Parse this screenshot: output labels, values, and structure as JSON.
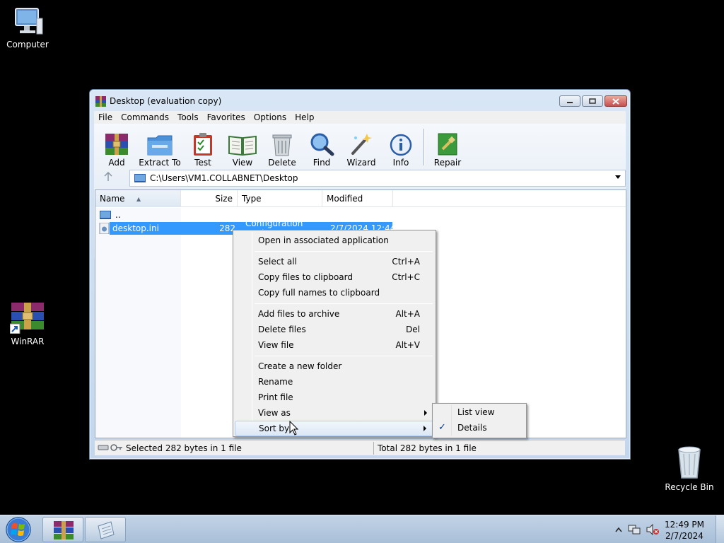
{
  "desktop": {
    "icons": [
      {
        "label": "Computer"
      },
      {
        "label": "WinRAR"
      },
      {
        "label": "Recycle Bin"
      }
    ]
  },
  "window": {
    "title": "Desktop (evaluation copy)",
    "menu": [
      "File",
      "Commands",
      "Tools",
      "Favorites",
      "Options",
      "Help"
    ],
    "toolbar": {
      "add": "Add",
      "extract": "Extract To",
      "test": "Test",
      "view": "View",
      "delete": "Delete",
      "find": "Find",
      "wizard": "Wizard",
      "info": "Info",
      "repair": "Repair"
    },
    "address": "C:\\Users\\VM1.COLLABNET\\Desktop",
    "columns": {
      "name": "Name",
      "size": "Size",
      "type": "Type",
      "modified": "Modified"
    },
    "rows": [
      {
        "name": "..",
        "size": "",
        "type": "",
        "modified": ""
      },
      {
        "name": "desktop.ini",
        "size": "282",
        "type": "Configuration setti...",
        "modified": "2/7/2024 12:44 ..."
      }
    ],
    "status": {
      "selected": "Selected 282 bytes in 1 file",
      "total": "Total 282 bytes in 1 file"
    }
  },
  "context_menu": {
    "open": "Open in associated application",
    "select_all": {
      "label": "Select all",
      "shortcut": "Ctrl+A"
    },
    "copy_files": {
      "label": "Copy files to clipboard",
      "shortcut": "Ctrl+C"
    },
    "copy_names": {
      "label": "Copy full names to clipboard"
    },
    "add_files": {
      "label": "Add files to archive",
      "shortcut": "Alt+A"
    },
    "delete_files": {
      "label": "Delete files",
      "shortcut": "Del"
    },
    "view_file": {
      "label": "View file",
      "shortcut": "Alt+V"
    },
    "new_folder": "Create a new folder",
    "rename": "Rename",
    "print": "Print file",
    "view_as": "View as",
    "sort_by": "Sort by"
  },
  "submenu": {
    "list_view": "List view",
    "details": "Details",
    "checked": "✓"
  },
  "taskbar": {
    "time": "12:49 PM",
    "date": "2/7/2024"
  }
}
